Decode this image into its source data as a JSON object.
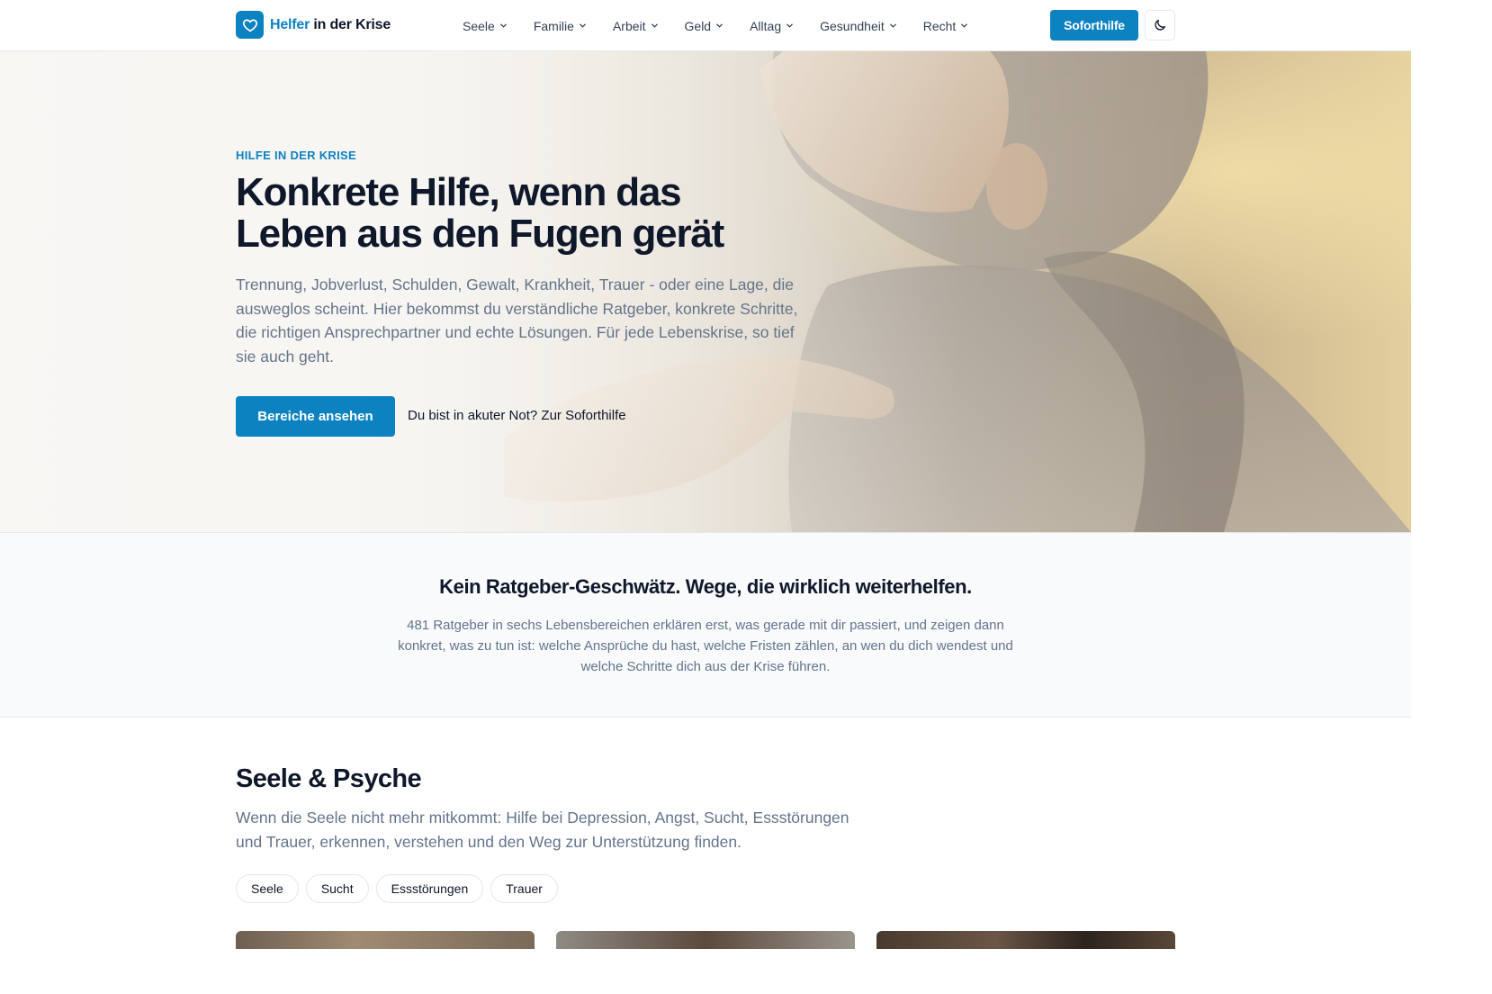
{
  "brand": {
    "name_accent": "Helfer",
    "name_rest": " in der Krise",
    "logo_icon": "heart-icon",
    "accent_color": "#0d82c1"
  },
  "nav": {
    "items": [
      {
        "label": "Seele"
      },
      {
        "label": "Familie"
      },
      {
        "label": "Arbeit"
      },
      {
        "label": "Geld"
      },
      {
        "label": "Alltag"
      },
      {
        "label": "Gesundheit"
      },
      {
        "label": "Recht"
      }
    ],
    "sofort_label": "Soforthilfe",
    "theme_icon": "moon-icon"
  },
  "hero": {
    "eyebrow": "HILFE IN DER KRISE",
    "title": "Konkrete Hilfe, wenn das Leben aus den Fugen gerät",
    "lead": "Trennung, Jobverlust, Schulden, Gewalt, Krankheit, Trauer - oder eine Lage, die ausweglos scheint. Hier bekommst du verständliche Ratgeber, konkrete Schritte, die richtigen Ansprechpartner und echte Lösungen. Für jede Lebenskrise, so tief sie auch geht.",
    "cta_primary": "Bereiche ansehen",
    "cta_link": "Du bist in akuter Not? Zur Soforthilfe"
  },
  "intro": {
    "title": "Kein Ratgeber-Geschwätz. Wege, die wirklich weiterhelfen.",
    "text": "481 Ratgeber in sechs Lebensbereichen erklären erst, was gerade mit dir passiert, und zeigen dann konkret, was zu tun ist: welche Ansprüche du hast, welche Fristen zählen, an wen du dich wendest und welche Schritte dich aus der Krise führen."
  },
  "section": {
    "title": "Seele & Psyche",
    "lead": "Wenn die Seele nicht mehr mitkommt: Hilfe bei Depression, Angst, Sucht, Essstörungen und Trauer, erkennen, verstehen und den Weg zur Unterstützung finden.",
    "chips": [
      {
        "label": "Seele"
      },
      {
        "label": "Sucht"
      },
      {
        "label": "Essstörungen"
      },
      {
        "label": "Trauer"
      }
    ]
  }
}
